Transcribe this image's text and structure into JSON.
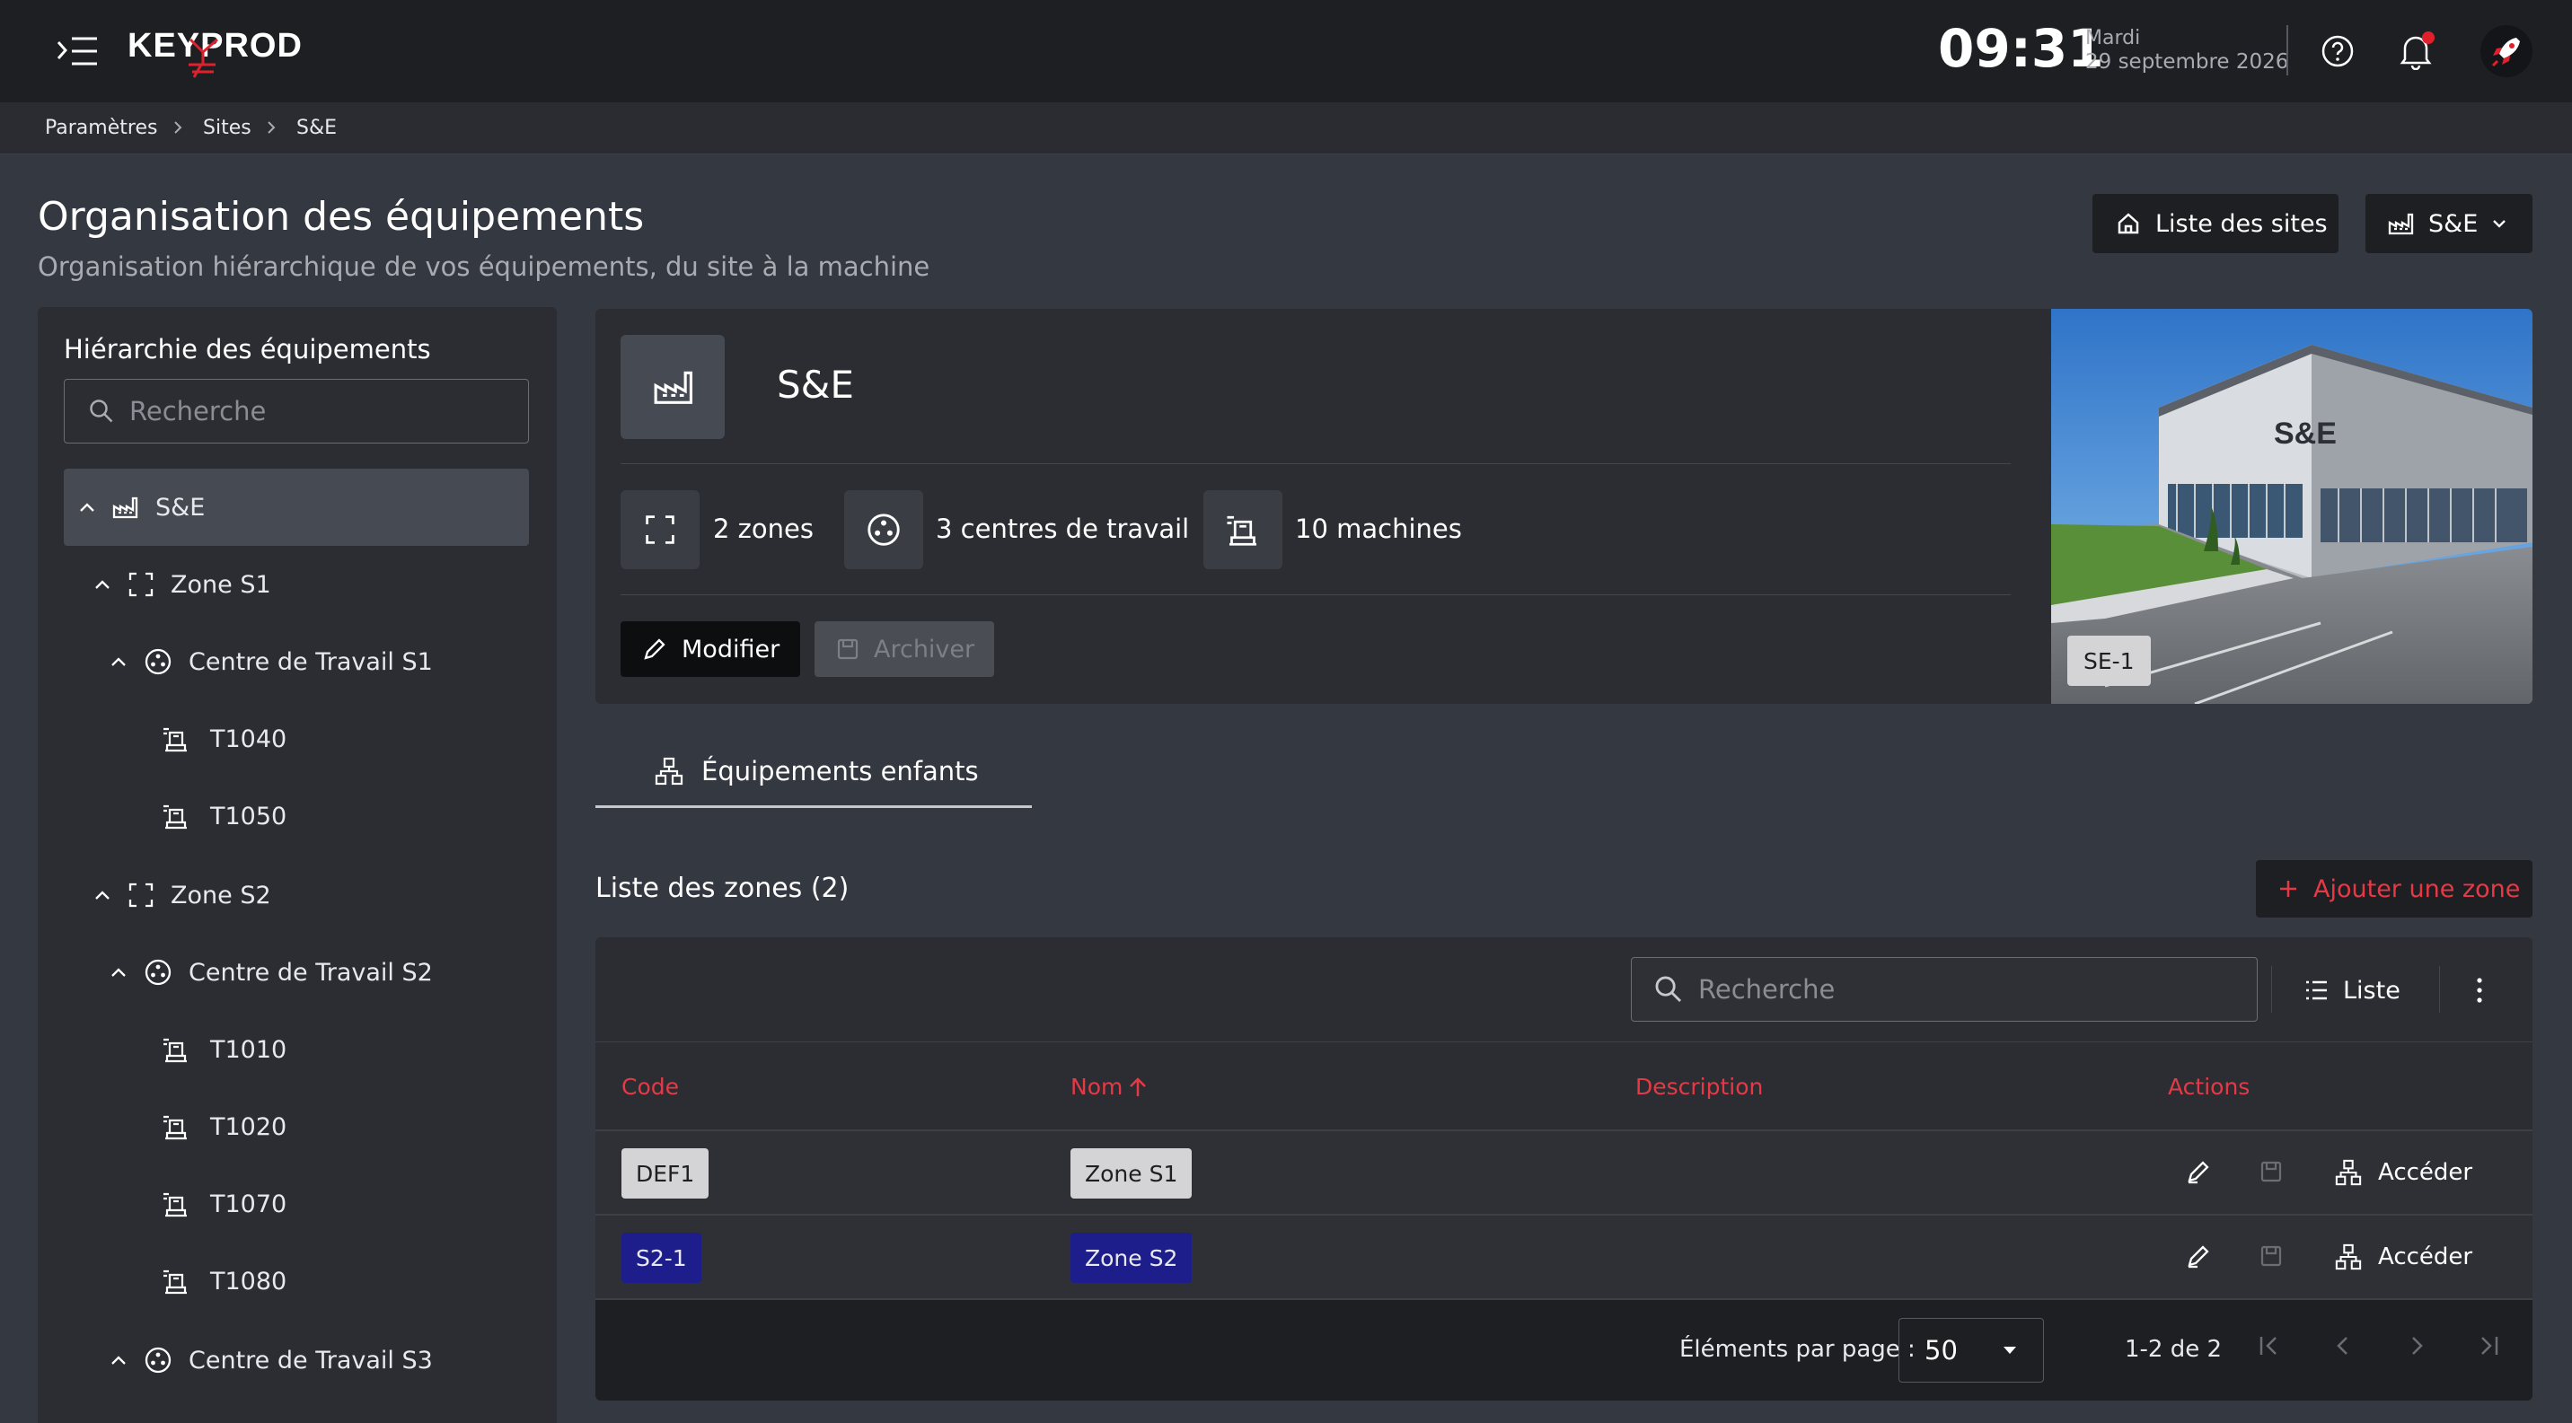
{
  "header": {
    "logo_text": "KEYPROD",
    "time": "09:31",
    "day": "Mardi",
    "date": "29 septembre 2026"
  },
  "breadcrumb": [
    "Paramètres",
    "Sites",
    "S&E"
  ],
  "page": {
    "title": "Organisation des équipements",
    "subtitle": "Organisation hiérarchique de vos équipements, du site à la machine",
    "sites_list_button": "Liste des sites",
    "site_selector": "S&E"
  },
  "sidebar": {
    "title": "Hiérarchie des équipements",
    "search_placeholder": "Recherche",
    "tree": [
      {
        "label": "S&E",
        "type": "site"
      },
      {
        "label": "Zone S1",
        "type": "zone"
      },
      {
        "label": "Centre de Travail S1",
        "type": "workcenter"
      },
      {
        "label": "T1040",
        "type": "machine"
      },
      {
        "label": "T1050",
        "type": "machine"
      },
      {
        "label": "Zone S2",
        "type": "zone"
      },
      {
        "label": "Centre de Travail S2",
        "type": "workcenter"
      },
      {
        "label": "T1010",
        "type": "machine"
      },
      {
        "label": "T1020",
        "type": "machine"
      },
      {
        "label": "T1070",
        "type": "machine"
      },
      {
        "label": "T1080",
        "type": "machine"
      },
      {
        "label": "Centre de Travail S3",
        "type": "workcenter"
      }
    ]
  },
  "site_card": {
    "name": "S&E",
    "stats": {
      "zones": "2 zones",
      "workcenters": "3 centres de travail",
      "machines": "10 machines"
    },
    "edit_button": "Modifier",
    "archive_button": "Archiver",
    "image_code": "SE-1",
    "image_sign": "S&E"
  },
  "tabs": {
    "children": "Équipements enfants"
  },
  "zones": {
    "title": "Liste des zones (2)",
    "add_button": "Ajouter une zone",
    "search_placeholder": "Recherche",
    "view_button": "Liste",
    "columns": {
      "code": "Code",
      "name": "Nom",
      "description": "Description",
      "actions": "Actions"
    },
    "rows": [
      {
        "code": "DEF1",
        "name": "Zone S1",
        "description": "",
        "access": "Accéder"
      },
      {
        "code": "S2-1",
        "name": "Zone S2",
        "description": "",
        "access": "Accéder"
      }
    ],
    "pagination": {
      "per_page_label": "Éléments par page :",
      "per_page": "50",
      "range": "1-2 de 2"
    }
  },
  "colors": {
    "accent": "#e53a46",
    "bg": "#343840",
    "panel": "#2b2d32",
    "topbar": "#1e1f22",
    "blue_chip": "#1d1e8c"
  }
}
